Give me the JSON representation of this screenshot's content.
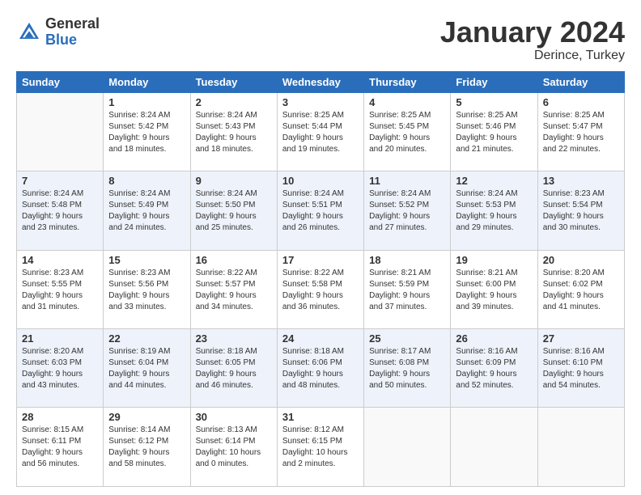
{
  "header": {
    "logo_general": "General",
    "logo_blue": "Blue",
    "month_title": "January 2024",
    "location": "Derince, Turkey"
  },
  "weekdays": [
    "Sunday",
    "Monday",
    "Tuesday",
    "Wednesday",
    "Thursday",
    "Friday",
    "Saturday"
  ],
  "weeks": [
    [
      {
        "day": null
      },
      {
        "day": 1,
        "sunrise": "8:24 AM",
        "sunset": "5:42 PM",
        "daylight": "9 hours and 18 minutes."
      },
      {
        "day": 2,
        "sunrise": "8:24 AM",
        "sunset": "5:43 PM",
        "daylight": "9 hours and 18 minutes."
      },
      {
        "day": 3,
        "sunrise": "8:25 AM",
        "sunset": "5:44 PM",
        "daylight": "9 hours and 19 minutes."
      },
      {
        "day": 4,
        "sunrise": "8:25 AM",
        "sunset": "5:45 PM",
        "daylight": "9 hours and 20 minutes."
      },
      {
        "day": 5,
        "sunrise": "8:25 AM",
        "sunset": "5:46 PM",
        "daylight": "9 hours and 21 minutes."
      },
      {
        "day": 6,
        "sunrise": "8:25 AM",
        "sunset": "5:47 PM",
        "daylight": "9 hours and 22 minutes."
      }
    ],
    [
      {
        "day": 7,
        "sunrise": "8:24 AM",
        "sunset": "5:48 PM",
        "daylight": "9 hours and 23 minutes."
      },
      {
        "day": 8,
        "sunrise": "8:24 AM",
        "sunset": "5:49 PM",
        "daylight": "9 hours and 24 minutes."
      },
      {
        "day": 9,
        "sunrise": "8:24 AM",
        "sunset": "5:50 PM",
        "daylight": "9 hours and 25 minutes."
      },
      {
        "day": 10,
        "sunrise": "8:24 AM",
        "sunset": "5:51 PM",
        "daylight": "9 hours and 26 minutes."
      },
      {
        "day": 11,
        "sunrise": "8:24 AM",
        "sunset": "5:52 PM",
        "daylight": "9 hours and 27 minutes."
      },
      {
        "day": 12,
        "sunrise": "8:24 AM",
        "sunset": "5:53 PM",
        "daylight": "9 hours and 29 minutes."
      },
      {
        "day": 13,
        "sunrise": "8:23 AM",
        "sunset": "5:54 PM",
        "daylight": "9 hours and 30 minutes."
      }
    ],
    [
      {
        "day": 14,
        "sunrise": "8:23 AM",
        "sunset": "5:55 PM",
        "daylight": "9 hours and 31 minutes."
      },
      {
        "day": 15,
        "sunrise": "8:23 AM",
        "sunset": "5:56 PM",
        "daylight": "9 hours and 33 minutes."
      },
      {
        "day": 16,
        "sunrise": "8:22 AM",
        "sunset": "5:57 PM",
        "daylight": "9 hours and 34 minutes."
      },
      {
        "day": 17,
        "sunrise": "8:22 AM",
        "sunset": "5:58 PM",
        "daylight": "9 hours and 36 minutes."
      },
      {
        "day": 18,
        "sunrise": "8:21 AM",
        "sunset": "5:59 PM",
        "daylight": "9 hours and 37 minutes."
      },
      {
        "day": 19,
        "sunrise": "8:21 AM",
        "sunset": "6:00 PM",
        "daylight": "9 hours and 39 minutes."
      },
      {
        "day": 20,
        "sunrise": "8:20 AM",
        "sunset": "6:02 PM",
        "daylight": "9 hours and 41 minutes."
      }
    ],
    [
      {
        "day": 21,
        "sunrise": "8:20 AM",
        "sunset": "6:03 PM",
        "daylight": "9 hours and 43 minutes."
      },
      {
        "day": 22,
        "sunrise": "8:19 AM",
        "sunset": "6:04 PM",
        "daylight": "9 hours and 44 minutes."
      },
      {
        "day": 23,
        "sunrise": "8:18 AM",
        "sunset": "6:05 PM",
        "daylight": "9 hours and 46 minutes."
      },
      {
        "day": 24,
        "sunrise": "8:18 AM",
        "sunset": "6:06 PM",
        "daylight": "9 hours and 48 minutes."
      },
      {
        "day": 25,
        "sunrise": "8:17 AM",
        "sunset": "6:08 PM",
        "daylight": "9 hours and 50 minutes."
      },
      {
        "day": 26,
        "sunrise": "8:16 AM",
        "sunset": "6:09 PM",
        "daylight": "9 hours and 52 minutes."
      },
      {
        "day": 27,
        "sunrise": "8:16 AM",
        "sunset": "6:10 PM",
        "daylight": "9 hours and 54 minutes."
      }
    ],
    [
      {
        "day": 28,
        "sunrise": "8:15 AM",
        "sunset": "6:11 PM",
        "daylight": "9 hours and 56 minutes."
      },
      {
        "day": 29,
        "sunrise": "8:14 AM",
        "sunset": "6:12 PM",
        "daylight": "9 hours and 58 minutes."
      },
      {
        "day": 30,
        "sunrise": "8:13 AM",
        "sunset": "6:14 PM",
        "daylight": "10 hours and 0 minutes."
      },
      {
        "day": 31,
        "sunrise": "8:12 AM",
        "sunset": "6:15 PM",
        "daylight": "10 hours and 2 minutes."
      },
      {
        "day": null
      },
      {
        "day": null
      },
      {
        "day": null
      }
    ]
  ],
  "labels": {
    "sunrise_prefix": "Sunrise: ",
    "sunset_prefix": "Sunset: ",
    "daylight_prefix": "Daylight: "
  }
}
